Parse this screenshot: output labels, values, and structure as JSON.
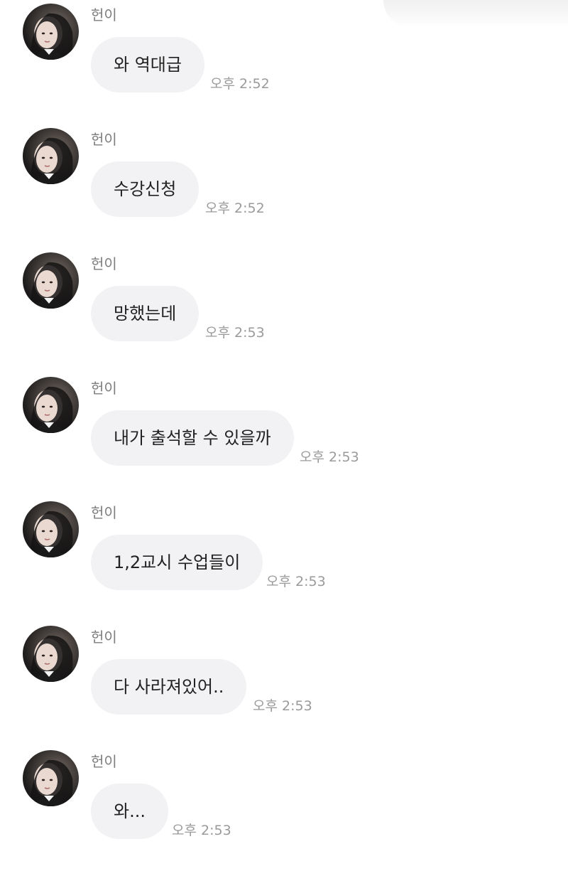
{
  "chat": {
    "messages": [
      {
        "sender": "헌이",
        "text": "와 역대급",
        "time": "오후 2:52"
      },
      {
        "sender": "헌이",
        "text": "수강신청",
        "time": "오후 2:52"
      },
      {
        "sender": "헌이",
        "text": "망했는데",
        "time": "오후 2:53"
      },
      {
        "sender": "헌이",
        "text": "내가 출석할 수 있을까",
        "time": "오후 2:53"
      },
      {
        "sender": "헌이",
        "text": "1,2교시 수업들이",
        "time": "오후 2:53"
      },
      {
        "sender": "헌이",
        "text": "다 사라져있어..",
        "time": "오후 2:53"
      },
      {
        "sender": "헌이",
        "text": "와...",
        "time": "오후 2:53"
      }
    ]
  },
  "colors": {
    "bubble_bg": "#f2f2f4",
    "text": "#222222",
    "sender": "#7d7d7d",
    "time": "#9a9a9a"
  },
  "icons": {
    "avatar": "profile-photo"
  }
}
